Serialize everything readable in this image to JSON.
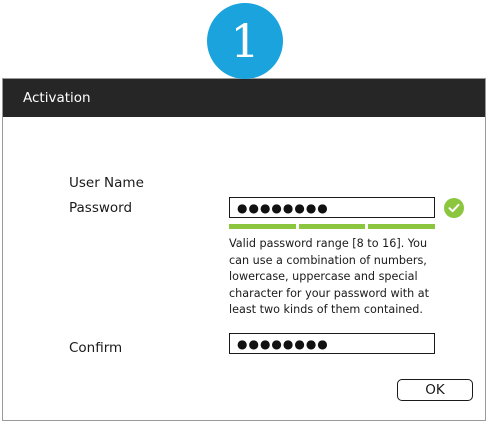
{
  "step": {
    "number": "1",
    "color": "#1aa3dd"
  },
  "dialog": {
    "title": "Activation",
    "titlebar_color": "#262626",
    "fields": {
      "username_label": "User Name",
      "password_label": "Password",
      "password_value": "●●●●●●●●",
      "password_valid": true,
      "password_strength_segments": 3,
      "password_strength_filled": 3,
      "strength_color": "#8cc63e",
      "confirm_label": "Confirm",
      "confirm_value": "●●●●●●●●"
    },
    "hint": "Valid password range [8 to 16]. You can use a combination of numbers, lowercase, uppercase and special character for your password with at least two kinds of them contained.",
    "ok_label": "OK"
  },
  "icons": {
    "valid": "check-circle-icon"
  }
}
